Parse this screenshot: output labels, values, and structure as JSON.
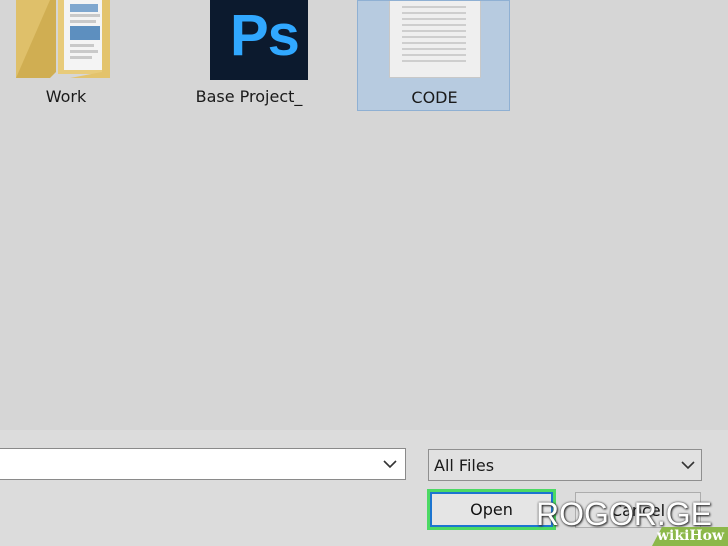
{
  "files": [
    {
      "label": "Work",
      "icon": "folder-icon"
    },
    {
      "label": "Base Project_",
      "icon": "photoshop-file-icon",
      "icon_text": "Ps"
    },
    {
      "label": "CODE",
      "icon": "text-document-icon",
      "selected": true
    }
  ],
  "filename_input": {
    "value": ""
  },
  "filetype": {
    "selected": "All Files"
  },
  "buttons": {
    "open": "Open",
    "cancel": "Cancel"
  },
  "watermark": {
    "text": "ROGOR.GE",
    "wikihow": "wikiHow"
  },
  "colors": {
    "selection": "#b7cbe0",
    "focus_highlight": "#4cd964",
    "focus_border": "#1c75d0",
    "ps_blue": "#31a8ff",
    "ps_bg": "#0c1a2e",
    "folder": "#e8c86a"
  }
}
